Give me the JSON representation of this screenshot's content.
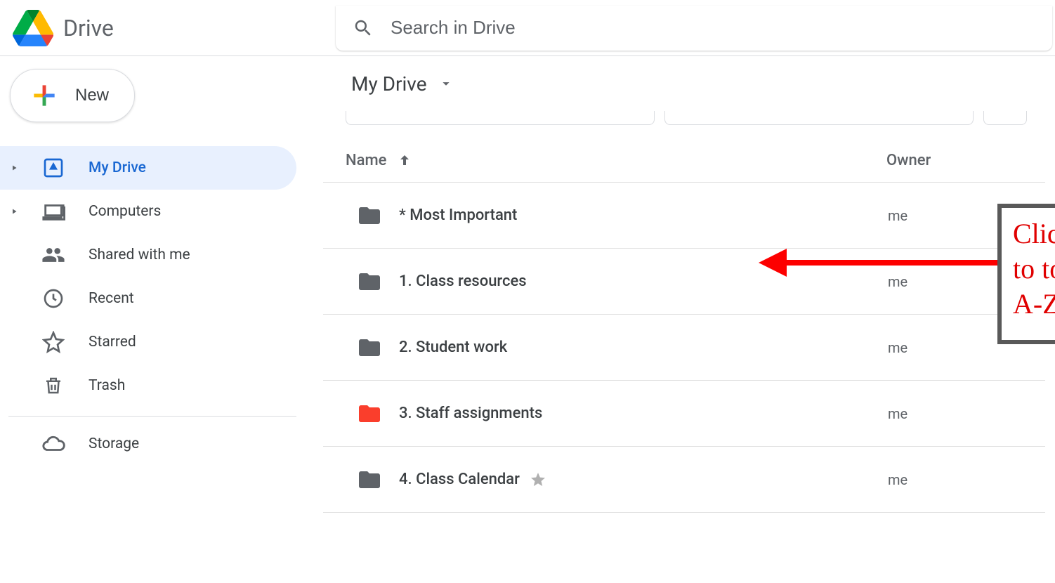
{
  "app": {
    "name": "Drive"
  },
  "search": {
    "placeholder": "Search in Drive"
  },
  "sidebar": {
    "new_label": "New",
    "items": [
      {
        "label": "My Drive",
        "icon": "drive"
      },
      {
        "label": "Computers",
        "icon": "computers"
      },
      {
        "label": "Shared with me",
        "icon": "shared"
      },
      {
        "label": "Recent",
        "icon": "recent"
      },
      {
        "label": "Starred",
        "icon": "star"
      },
      {
        "label": "Trash",
        "icon": "trash"
      }
    ],
    "storage_label": "Storage"
  },
  "main": {
    "breadcrumb": "My Drive",
    "columns": {
      "name": "Name",
      "owner": "Owner"
    },
    "rows": [
      {
        "name": "* Most Important",
        "owner": "me",
        "icon_color": "#5f6368",
        "starred": false
      },
      {
        "name": "1. Class resources",
        "owner": "me",
        "icon_color": "#5f6368",
        "starred": false
      },
      {
        "name": "2. Student work",
        "owner": "me",
        "icon_color": "#5f6368",
        "starred": false
      },
      {
        "name": "3. Staff assignments",
        "owner": "me",
        "icon_color": "#fa3e2c",
        "starred": false
      },
      {
        "name": "4. Class Calendar",
        "owner": "me",
        "icon_color": "#5f6368",
        "starred": true
      }
    ]
  },
  "annotation": {
    "line1": "Click this arrow",
    "line2": "to toggle from",
    "line3": "A-Z or Z-A"
  }
}
